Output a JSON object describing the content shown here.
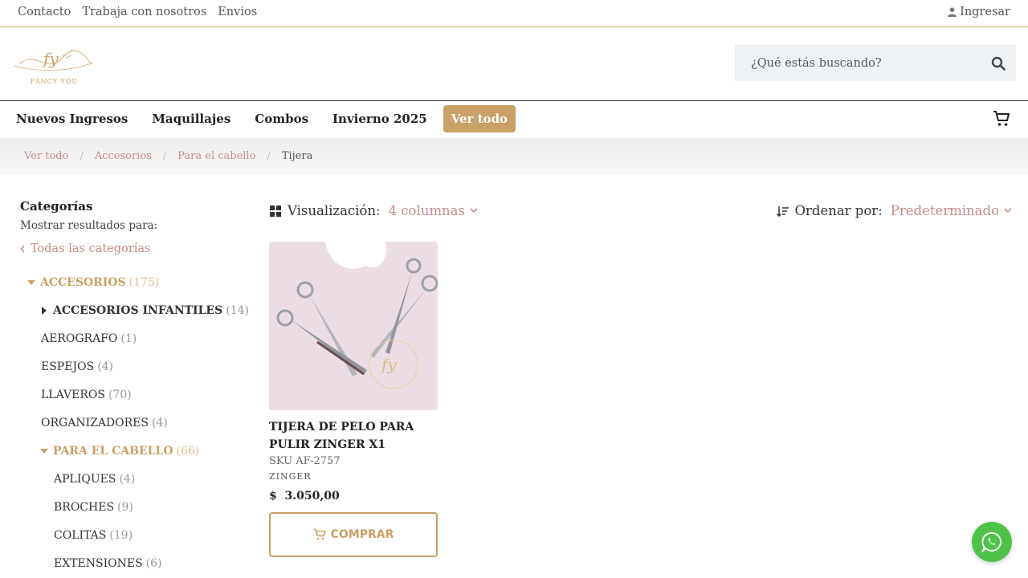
{
  "topbar": {
    "links": [
      "Contacto",
      "Trabaja con nosotros",
      "Envios"
    ],
    "login": "Ingresar"
  },
  "header": {
    "logo_text": "FANCY YOU",
    "search_placeholder": "¿Qué estás buscando?"
  },
  "nav": {
    "items": [
      "Nuevos Ingresos",
      "Maquillajes",
      "Combos",
      "Invierno 2025",
      "Ver todo"
    ]
  },
  "breadcrumb": [
    "Ver todo",
    "Accesorios",
    "Para el cabello",
    "Tijera"
  ],
  "sidebar": {
    "title": "Categorías",
    "subtitle": "Mostrar resultados para:",
    "all_link": "Todas las categorías",
    "categories": [
      {
        "label": "ACCESORIOS",
        "count": "(175)"
      },
      {
        "label": "ACCESORIOS INFANTILES",
        "count": "(14)"
      },
      {
        "label": "AEROGRAFO",
        "count": "(1)"
      },
      {
        "label": "ESPEJOS",
        "count": "(4)"
      },
      {
        "label": "LLAVEROS",
        "count": "(70)"
      },
      {
        "label": "ORGANIZADORES",
        "count": "(4)"
      },
      {
        "label": "PARA EL CABELLO",
        "count": "(66)"
      },
      {
        "label": "APLIQUES",
        "count": "(4)"
      },
      {
        "label": "BROCHES",
        "count": "(9)"
      },
      {
        "label": "COLITAS",
        "count": "(19)"
      },
      {
        "label": "EXTENSIONES",
        "count": "(6)"
      }
    ]
  },
  "toolbar": {
    "view_label": "Visualización:",
    "view_value": "4 columnas",
    "sort_label": "Ordenar por:",
    "sort_value": "Predeterminado"
  },
  "product": {
    "name": "TIJERA DE PELO PARA PULIR ZINGER X1",
    "sku": "SKU AF-2757",
    "brand": "ZINGER",
    "price": "$  3.050,00",
    "buy_label": "COMPRAR",
    "watermark": "fy"
  },
  "colors": {
    "accent_gold": "#c9a065",
    "link_rose": "#c98a8a",
    "whatsapp_green": "#4dc247"
  }
}
